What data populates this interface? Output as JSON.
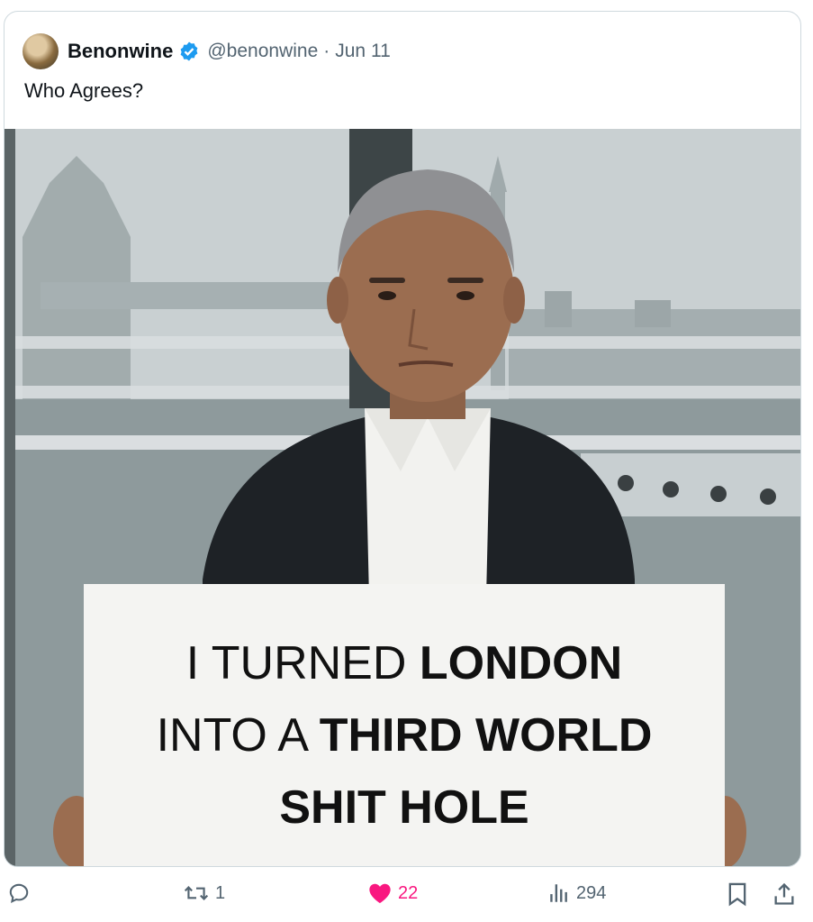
{
  "tweet": {
    "author_name": "Benonwine",
    "handle": "@benonwine",
    "separator": "·",
    "date": "Jun 11",
    "text": "Who Agrees?"
  },
  "image": {
    "sign_lines": [
      {
        "regular": "I TURNED ",
        "bold": "LONDON"
      },
      {
        "regular": "INTO A ",
        "bold": "THIRD WORLD"
      },
      {
        "regular": "",
        "bold": "SHIT HOLE"
      }
    ]
  },
  "actions": {
    "reply_count": "",
    "retweet_count": "1",
    "like_count": "22",
    "views_count": "294"
  },
  "colors": {
    "verified": "#1d9bf0",
    "like": "#f91880",
    "muted": "#536471"
  }
}
